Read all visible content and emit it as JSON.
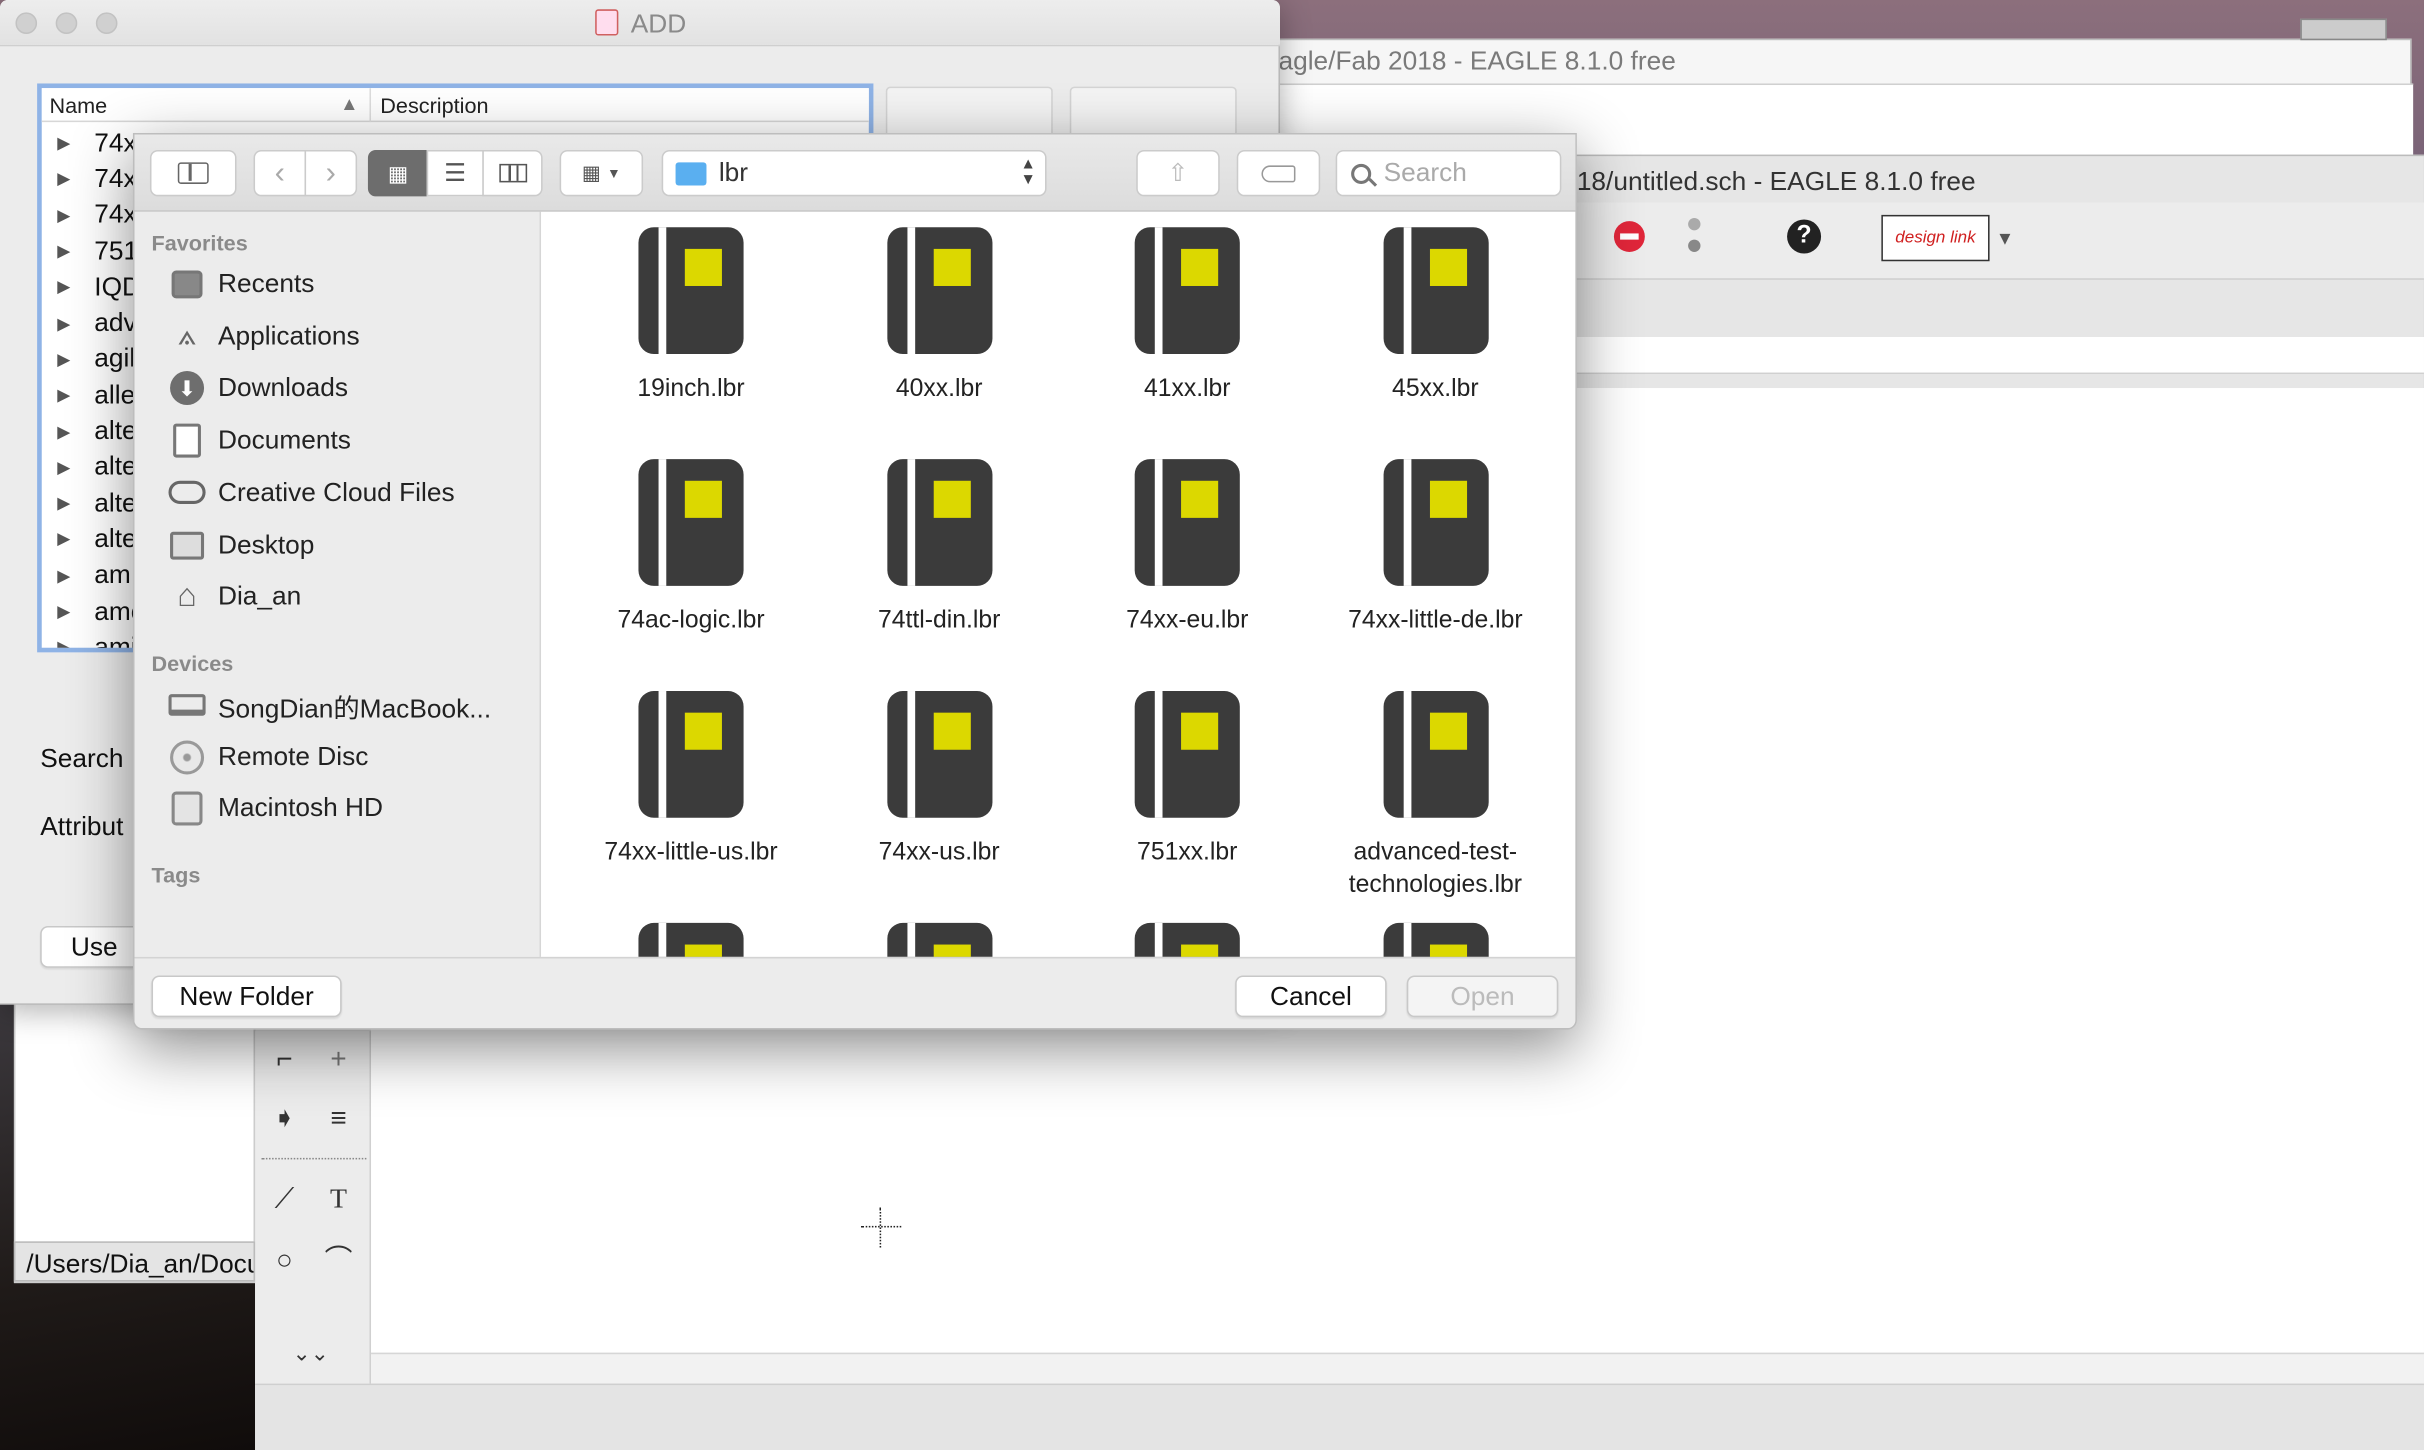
{
  "add_window": {
    "title": "ADD",
    "columns": {
      "name": "Name",
      "description": "Description"
    },
    "rows": [
      "74x",
      "74x",
      "74x",
      "751",
      "IQD",
      "adv",
      "agil",
      "alle",
      "alte",
      "alte",
      "alte",
      "alte",
      "am:",
      "amc",
      "ami"
    ],
    "search_label": "Search",
    "attributes_label": "Attribut",
    "use_button": "Use"
  },
  "eagle_back": {
    "title": "agle/Fab 2018 - EAGLE 8.1.0 free"
  },
  "eagle_front": {
    "title": "18/untitled.sch - EAGLE 8.1.0 free",
    "status_path": "/Users/Dia_an/Docu",
    "design_link": "design link"
  },
  "dialog": {
    "location": "lbr",
    "search_placeholder": "Search",
    "favorites_header": "Favorites",
    "favorites": [
      {
        "label": "Recents",
        "icon": "recents-icon"
      },
      {
        "label": "Applications",
        "icon": "applications-icon"
      },
      {
        "label": "Downloads",
        "icon": "downloads-icon"
      },
      {
        "label": "Documents",
        "icon": "documents-icon"
      },
      {
        "label": "Creative Cloud Files",
        "icon": "creative-cloud-icon"
      },
      {
        "label": "Desktop",
        "icon": "desktop-icon"
      },
      {
        "label": "Dia_an",
        "icon": "home-icon"
      }
    ],
    "devices_header": "Devices",
    "devices": [
      {
        "label": "SongDian的MacBook...",
        "icon": "laptop-icon"
      },
      {
        "label": "Remote Disc",
        "icon": "disc-icon"
      },
      {
        "label": "Macintosh HD",
        "icon": "hard-drive-icon"
      }
    ],
    "tags_header": "Tags",
    "files": [
      "19inch.lbr",
      "40xx.lbr",
      "41xx.lbr",
      "45xx.lbr",
      "74ac-logic.lbr",
      "74ttl-din.lbr",
      "74xx-eu.lbr",
      "74xx-little-de.lbr",
      "74xx-little-us.lbr",
      "74xx-us.lbr",
      "751xx.lbr",
      "advanced-test-technologies.lbr"
    ],
    "new_folder_button": "New Folder",
    "cancel_button": "Cancel",
    "open_button": "Open"
  },
  "colors": {
    "book": "#3b3b3b",
    "book_label": "#dcd800",
    "selection": "#8fb3e6",
    "stop_icon": "#e0263a"
  }
}
